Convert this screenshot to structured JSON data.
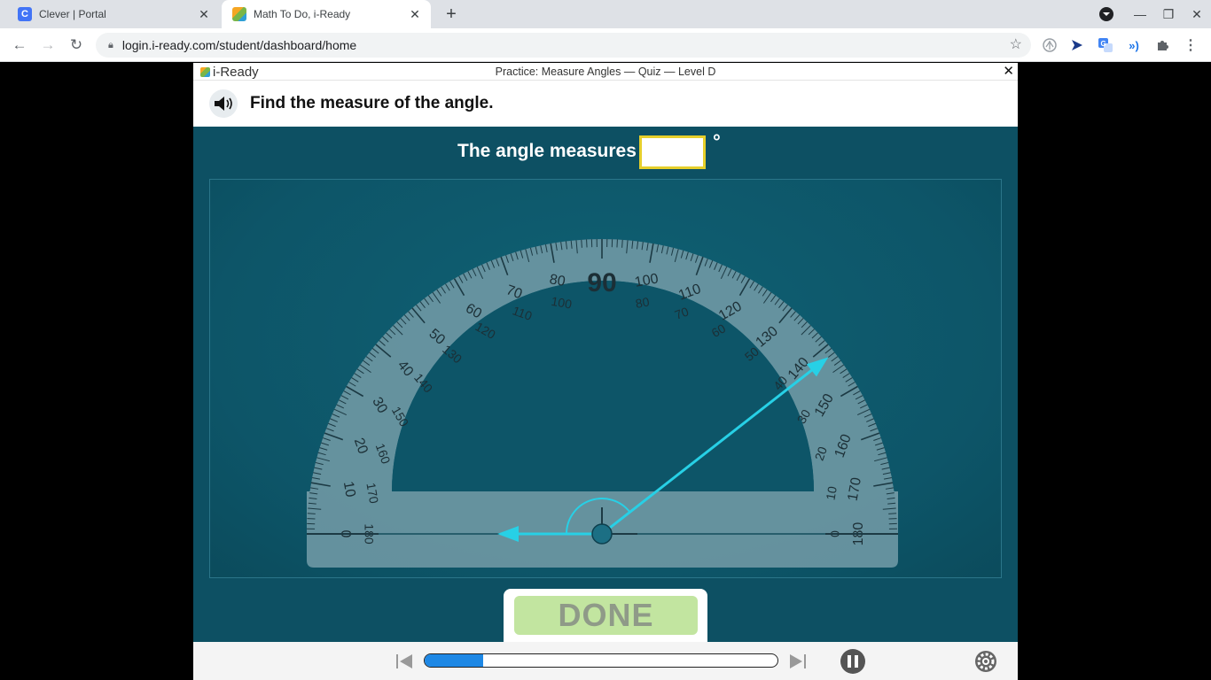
{
  "browser": {
    "tabs": [
      {
        "title": "Clever | Portal",
        "favicon": "C",
        "favicon_color": "#4274f6",
        "active": false
      },
      {
        "title": "Math To Do, i-Ready",
        "favicon": "",
        "favicon_color": "#f5a623",
        "active": true
      }
    ],
    "new_tab_label": "+",
    "url": "login.i-ready.com/student/dashboard/home",
    "window_controls": [
      "minimize",
      "restore",
      "close"
    ],
    "extensions": [
      "extension-icon",
      "send-icon",
      "translate-icon",
      "readaloud-icon",
      "puzzle-icon"
    ]
  },
  "app": {
    "logo_text": "i-Ready",
    "quiz_title": "Practice: Measure Angles — Quiz — Level D",
    "close_label": "✕",
    "prompt": "Find the measure of the angle.",
    "answer_label": "The angle measures",
    "answer_value": "",
    "degree_symbol": "°",
    "done_label": "DONE",
    "progress_fraction": 0.165,
    "accent_color": "#1e88e5"
  },
  "protractor": {
    "outer_labels": [
      "0",
      "10",
      "20",
      "30",
      "40",
      "50",
      "60",
      "70",
      "80",
      "90",
      "100",
      "110",
      "120",
      "130",
      "140",
      "150",
      "160",
      "170",
      "180"
    ],
    "inner_labels": [
      "180",
      "170",
      "160",
      "150",
      "140",
      "130",
      "120",
      "110",
      "100",
      "",
      "80",
      "70",
      "60",
      "50",
      "40",
      "30",
      "20",
      "10",
      "0"
    ],
    "ray_angle_deg": 142,
    "ray_color": "#27d0e6"
  }
}
